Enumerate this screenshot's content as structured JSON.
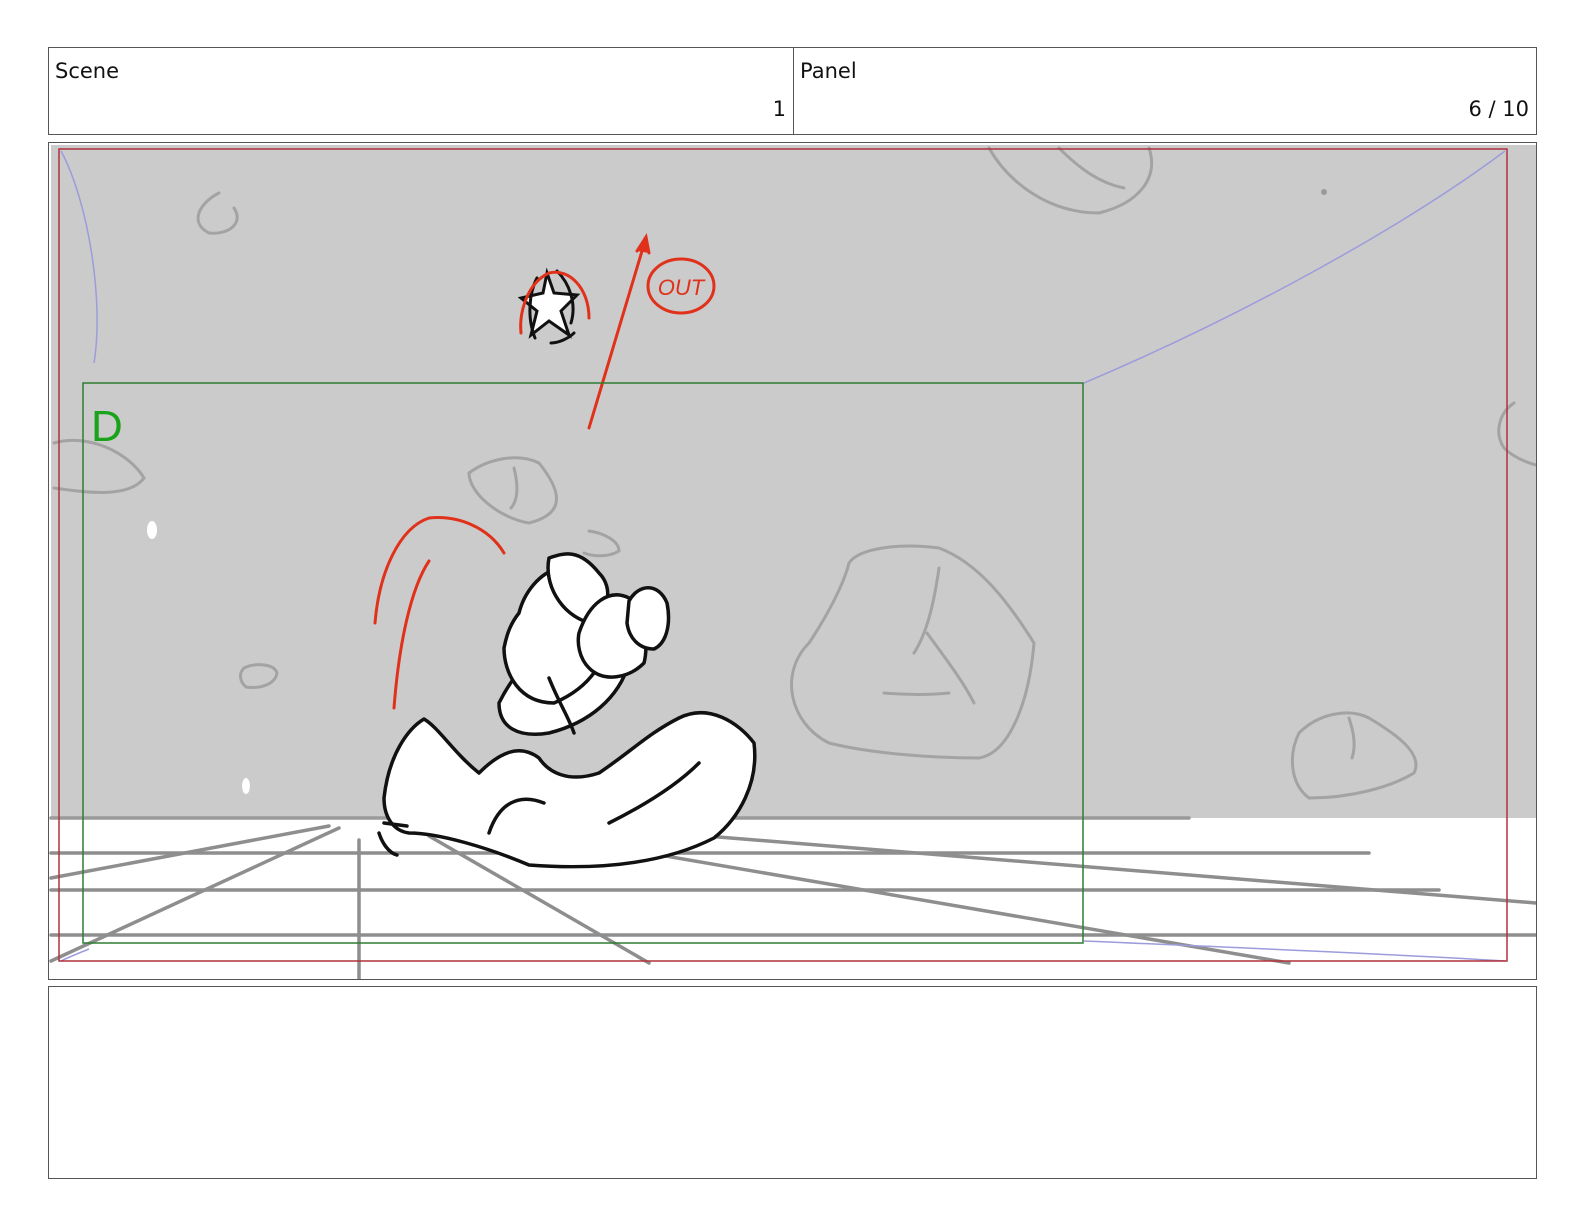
{
  "header": {
    "scene_label": "Scene",
    "scene_number": "1",
    "panel_label": "Panel",
    "panel_counter": "6 / 10"
  },
  "panel_image": {
    "field_label": "D",
    "annotation_text": "OUT",
    "colors": {
      "background_wall": "#cbcbcb",
      "floor": "#ffffff",
      "safe_frame": "#b0303a",
      "field_frame": "#2e7d32",
      "field_label": "#1aa31a",
      "annotation": "#e0311b",
      "camera_lines": "#9a9ad8",
      "sketch": "#111111",
      "rocks": "#9e9e9e"
    }
  },
  "notes": {
    "text": ""
  }
}
